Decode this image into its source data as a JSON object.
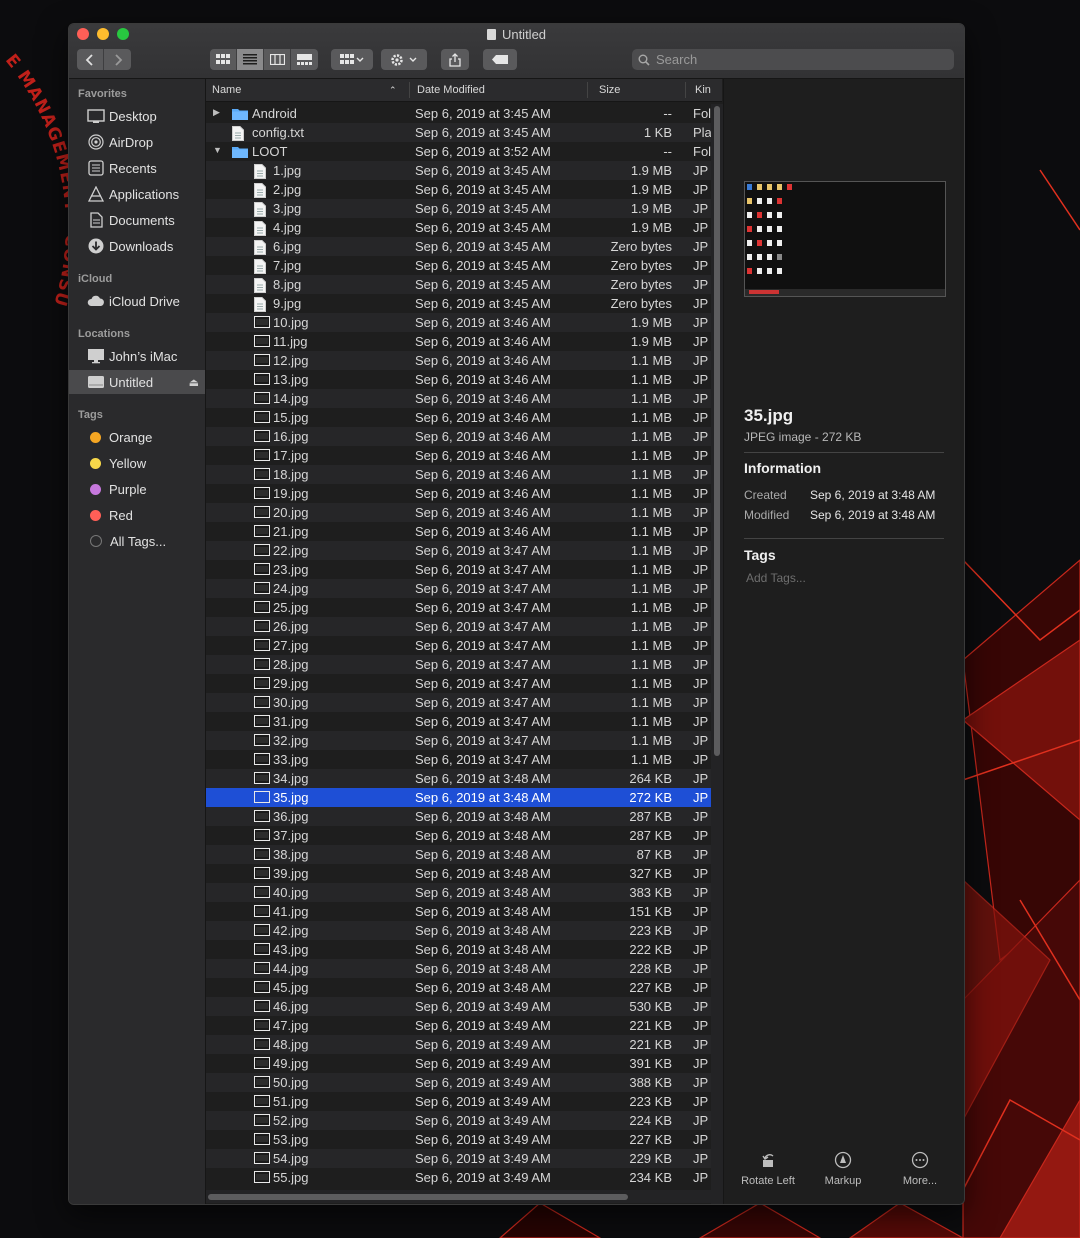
{
  "window": {
    "title": "Untitled"
  },
  "toolbar": {
    "search_placeholder": "Search",
    "icons": [
      "back-icon",
      "forward-icon",
      "icon-view-icon",
      "list-view-icon",
      "column-view-icon",
      "gallery-view-icon",
      "group-icon",
      "action-gear-icon",
      "share-icon",
      "tag-icon"
    ]
  },
  "sidebar": {
    "favorites_label": "Favorites",
    "favorites": [
      {
        "label": "Desktop",
        "icon": "desktop-icon"
      },
      {
        "label": "AirDrop",
        "icon": "airdrop-icon"
      },
      {
        "label": "Recents",
        "icon": "recents-icon"
      },
      {
        "label": "Applications",
        "icon": "applications-icon"
      },
      {
        "label": "Documents",
        "icon": "documents-icon"
      },
      {
        "label": "Downloads",
        "icon": "downloads-icon"
      }
    ],
    "icloud_label": "iCloud",
    "icloud": [
      {
        "label": "iCloud Drive",
        "icon": "cloud-icon"
      }
    ],
    "locations_label": "Locations",
    "locations": [
      {
        "label": "John’s iMac",
        "icon": "imac-icon"
      },
      {
        "label": "Untitled",
        "icon": "drive-icon",
        "selected": true
      }
    ],
    "tags_label": "Tags",
    "tags": [
      {
        "label": "Orange",
        "color": "#f5a623"
      },
      {
        "label": "Yellow",
        "color": "#f7d84a"
      },
      {
        "label": "Purple",
        "color": "#c678dd"
      },
      {
        "label": "Red",
        "color": "#ff5f57"
      },
      {
        "label": "All Tags...",
        "color": "#555555"
      }
    ]
  },
  "columns": {
    "name": "Name",
    "date": "Date Modified",
    "size": "Size",
    "kind": "Kin"
  },
  "files": [
    {
      "name": "Android",
      "date": "Sep 6, 2019 at 3:45 AM",
      "size": "--",
      "kind": "Fol",
      "type": "folder",
      "level": 0,
      "disclosure": "closed"
    },
    {
      "name": "config.txt",
      "date": "Sep 6, 2019 at 3:45 AM",
      "size": "1 KB",
      "kind": "Pla",
      "type": "doc",
      "level": 0
    },
    {
      "name": "LOOT",
      "date": "Sep 6, 2019 at 3:52 AM",
      "size": "--",
      "kind": "Fol",
      "type": "folder",
      "level": 0,
      "disclosure": "open"
    },
    {
      "name": "1.jpg",
      "date": "Sep 6, 2019 at 3:45 AM",
      "size": "1.9 MB",
      "kind": "JP",
      "type": "doc",
      "level": 1
    },
    {
      "name": "2.jpg",
      "date": "Sep 6, 2019 at 3:45 AM",
      "size": "1.9 MB",
      "kind": "JP",
      "type": "doc",
      "level": 1
    },
    {
      "name": "3.jpg",
      "date": "Sep 6, 2019 at 3:45 AM",
      "size": "1.9 MB",
      "kind": "JP",
      "type": "doc",
      "level": 1
    },
    {
      "name": "4.jpg",
      "date": "Sep 6, 2019 at 3:45 AM",
      "size": "1.9 MB",
      "kind": "JP",
      "type": "doc",
      "level": 1
    },
    {
      "name": "6.jpg",
      "date": "Sep 6, 2019 at 3:45 AM",
      "size": "Zero bytes",
      "kind": "JP",
      "type": "doc",
      "level": 1
    },
    {
      "name": "7.jpg",
      "date": "Sep 6, 2019 at 3:45 AM",
      "size": "Zero bytes",
      "kind": "JP",
      "type": "doc",
      "level": 1
    },
    {
      "name": "8.jpg",
      "date": "Sep 6, 2019 at 3:45 AM",
      "size": "Zero bytes",
      "kind": "JP",
      "type": "doc",
      "level": 1
    },
    {
      "name": "9.jpg",
      "date": "Sep 6, 2019 at 3:45 AM",
      "size": "Zero bytes",
      "kind": "JP",
      "type": "doc",
      "level": 1
    },
    {
      "name": "10.jpg",
      "date": "Sep 6, 2019 at 3:46 AM",
      "size": "1.9 MB",
      "kind": "JP",
      "type": "img",
      "level": 1
    },
    {
      "name": "11.jpg",
      "date": "Sep 6, 2019 at 3:46 AM",
      "size": "1.9 MB",
      "kind": "JP",
      "type": "img",
      "level": 1
    },
    {
      "name": "12.jpg",
      "date": "Sep 6, 2019 at 3:46 AM",
      "size": "1.1 MB",
      "kind": "JP",
      "type": "img",
      "level": 1
    },
    {
      "name": "13.jpg",
      "date": "Sep 6, 2019 at 3:46 AM",
      "size": "1.1 MB",
      "kind": "JP",
      "type": "img",
      "level": 1
    },
    {
      "name": "14.jpg",
      "date": "Sep 6, 2019 at 3:46 AM",
      "size": "1.1 MB",
      "kind": "JP",
      "type": "img",
      "level": 1
    },
    {
      "name": "15.jpg",
      "date": "Sep 6, 2019 at 3:46 AM",
      "size": "1.1 MB",
      "kind": "JP",
      "type": "img",
      "level": 1
    },
    {
      "name": "16.jpg",
      "date": "Sep 6, 2019 at 3:46 AM",
      "size": "1.1 MB",
      "kind": "JP",
      "type": "img",
      "level": 1
    },
    {
      "name": "17.jpg",
      "date": "Sep 6, 2019 at 3:46 AM",
      "size": "1.1 MB",
      "kind": "JP",
      "type": "img",
      "level": 1
    },
    {
      "name": "18.jpg",
      "date": "Sep 6, 2019 at 3:46 AM",
      "size": "1.1 MB",
      "kind": "JP",
      "type": "img",
      "level": 1
    },
    {
      "name": "19.jpg",
      "date": "Sep 6, 2019 at 3:46 AM",
      "size": "1.1 MB",
      "kind": "JP",
      "type": "img",
      "level": 1
    },
    {
      "name": "20.jpg",
      "date": "Sep 6, 2019 at 3:46 AM",
      "size": "1.1 MB",
      "kind": "JP",
      "type": "img",
      "level": 1
    },
    {
      "name": "21.jpg",
      "date": "Sep 6, 2019 at 3:46 AM",
      "size": "1.1 MB",
      "kind": "JP",
      "type": "img",
      "level": 1
    },
    {
      "name": "22.jpg",
      "date": "Sep 6, 2019 at 3:47 AM",
      "size": "1.1 MB",
      "kind": "JP",
      "type": "img",
      "level": 1
    },
    {
      "name": "23.jpg",
      "date": "Sep 6, 2019 at 3:47 AM",
      "size": "1.1 MB",
      "kind": "JP",
      "type": "img",
      "level": 1
    },
    {
      "name": "24.jpg",
      "date": "Sep 6, 2019 at 3:47 AM",
      "size": "1.1 MB",
      "kind": "JP",
      "type": "img",
      "level": 1
    },
    {
      "name": "25.jpg",
      "date": "Sep 6, 2019 at 3:47 AM",
      "size": "1.1 MB",
      "kind": "JP",
      "type": "img",
      "level": 1
    },
    {
      "name": "26.jpg",
      "date": "Sep 6, 2019 at 3:47 AM",
      "size": "1.1 MB",
      "kind": "JP",
      "type": "img",
      "level": 1
    },
    {
      "name": "27.jpg",
      "date": "Sep 6, 2019 at 3:47 AM",
      "size": "1.1 MB",
      "kind": "JP",
      "type": "img",
      "level": 1
    },
    {
      "name": "28.jpg",
      "date": "Sep 6, 2019 at 3:47 AM",
      "size": "1.1 MB",
      "kind": "JP",
      "type": "img",
      "level": 1
    },
    {
      "name": "29.jpg",
      "date": "Sep 6, 2019 at 3:47 AM",
      "size": "1.1 MB",
      "kind": "JP",
      "type": "img",
      "level": 1
    },
    {
      "name": "30.jpg",
      "date": "Sep 6, 2019 at 3:47 AM",
      "size": "1.1 MB",
      "kind": "JP",
      "type": "img",
      "level": 1
    },
    {
      "name": "31.jpg",
      "date": "Sep 6, 2019 at 3:47 AM",
      "size": "1.1 MB",
      "kind": "JP",
      "type": "img",
      "level": 1
    },
    {
      "name": "32.jpg",
      "date": "Sep 6, 2019 at 3:47 AM",
      "size": "1.1 MB",
      "kind": "JP",
      "type": "img",
      "level": 1
    },
    {
      "name": "33.jpg",
      "date": "Sep 6, 2019 at 3:47 AM",
      "size": "1.1 MB",
      "kind": "JP",
      "type": "img",
      "level": 1
    },
    {
      "name": "34.jpg",
      "date": "Sep 6, 2019 at 3:48 AM",
      "size": "264 KB",
      "kind": "JP",
      "type": "img",
      "level": 1
    },
    {
      "name": "35.jpg",
      "date": "Sep 6, 2019 at 3:48 AM",
      "size": "272 KB",
      "kind": "JP",
      "type": "img",
      "level": 1,
      "selected": true
    },
    {
      "name": "36.jpg",
      "date": "Sep 6, 2019 at 3:48 AM",
      "size": "287 KB",
      "kind": "JP",
      "type": "img",
      "level": 1
    },
    {
      "name": "37.jpg",
      "date": "Sep 6, 2019 at 3:48 AM",
      "size": "287 KB",
      "kind": "JP",
      "type": "img",
      "level": 1
    },
    {
      "name": "38.jpg",
      "date": "Sep 6, 2019 at 3:48 AM",
      "size": "87 KB",
      "kind": "JP",
      "type": "img",
      "level": 1
    },
    {
      "name": "39.jpg",
      "date": "Sep 6, 2019 at 3:48 AM",
      "size": "327 KB",
      "kind": "JP",
      "type": "img",
      "level": 1
    },
    {
      "name": "40.jpg",
      "date": "Sep 6, 2019 at 3:48 AM",
      "size": "383 KB",
      "kind": "JP",
      "type": "img",
      "level": 1
    },
    {
      "name": "41.jpg",
      "date": "Sep 6, 2019 at 3:48 AM",
      "size": "151 KB",
      "kind": "JP",
      "type": "img",
      "level": 1
    },
    {
      "name": "42.jpg",
      "date": "Sep 6, 2019 at 3:48 AM",
      "size": "223 KB",
      "kind": "JP",
      "type": "img",
      "level": 1
    },
    {
      "name": "43.jpg",
      "date": "Sep 6, 2019 at 3:48 AM",
      "size": "222 KB",
      "kind": "JP",
      "type": "img",
      "level": 1
    },
    {
      "name": "44.jpg",
      "date": "Sep 6, 2019 at 3:48 AM",
      "size": "228 KB",
      "kind": "JP",
      "type": "img",
      "level": 1
    },
    {
      "name": "45.jpg",
      "date": "Sep 6, 2019 at 3:48 AM",
      "size": "227 KB",
      "kind": "JP",
      "type": "img",
      "level": 1
    },
    {
      "name": "46.jpg",
      "date": "Sep 6, 2019 at 3:49 AM",
      "size": "530 KB",
      "kind": "JP",
      "type": "img",
      "level": 1
    },
    {
      "name": "47.jpg",
      "date": "Sep 6, 2019 at 3:49 AM",
      "size": "221 KB",
      "kind": "JP",
      "type": "img",
      "level": 1
    },
    {
      "name": "48.jpg",
      "date": "Sep 6, 2019 at 3:49 AM",
      "size": "221 KB",
      "kind": "JP",
      "type": "img",
      "level": 1
    },
    {
      "name": "49.jpg",
      "date": "Sep 6, 2019 at 3:49 AM",
      "size": "391 KB",
      "kind": "JP",
      "type": "img",
      "level": 1
    },
    {
      "name": "50.jpg",
      "date": "Sep 6, 2019 at 3:49 AM",
      "size": "388 KB",
      "kind": "JP",
      "type": "img",
      "level": 1
    },
    {
      "name": "51.jpg",
      "date": "Sep 6, 2019 at 3:49 AM",
      "size": "223 KB",
      "kind": "JP",
      "type": "img",
      "level": 1
    },
    {
      "name": "52.jpg",
      "date": "Sep 6, 2019 at 3:49 AM",
      "size": "224 KB",
      "kind": "JP",
      "type": "img",
      "level": 1
    },
    {
      "name": "53.jpg",
      "date": "Sep 6, 2019 at 3:49 AM",
      "size": "227 KB",
      "kind": "JP",
      "type": "img",
      "level": 1
    },
    {
      "name": "54.jpg",
      "date": "Sep 6, 2019 at 3:49 AM",
      "size": "229 KB",
      "kind": "JP",
      "type": "img",
      "level": 1
    },
    {
      "name": "55.jpg",
      "date": "Sep 6, 2019 at 3:49 AM",
      "size": "234 KB",
      "kind": "JP",
      "type": "img",
      "level": 1
    }
  ],
  "preview": {
    "filename": "35.jpg",
    "kind": "JPEG image - 272 KB",
    "info_title": "Information",
    "created_label": "Created",
    "created_value": "Sep 6, 2019 at 3:48 AM",
    "modified_label": "Modified",
    "modified_value": "Sep 6, 2019 at 3:48 AM",
    "tags_title": "Tags",
    "add_tags": "Add Tags...",
    "actions": [
      {
        "label": "Rotate Left",
        "icon": "rotate-left-icon"
      },
      {
        "label": "Markup",
        "icon": "markup-icon"
      },
      {
        "label": "More...",
        "icon": "more-icon"
      }
    ]
  },
  "background": {
    "text": "E MANAGEMENT · CONSU",
    "accent": "#c0201a"
  },
  "colors": {
    "selection": "#1e4fd6",
    "folder": "#5aa9f5"
  }
}
